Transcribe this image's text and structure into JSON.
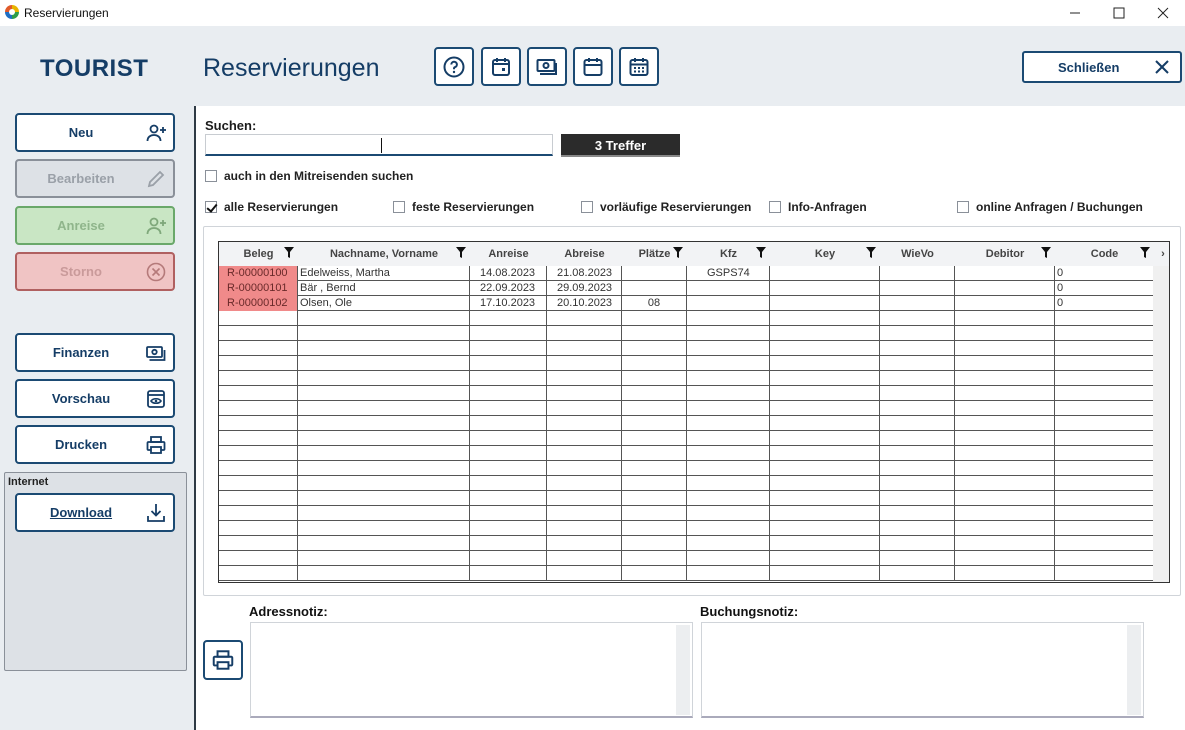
{
  "window": {
    "title": "Reservierungen",
    "minimize": "—",
    "maximize": "☐",
    "close": "✕"
  },
  "header": {
    "brand": "TOURIST",
    "title": "Reservierungen",
    "close_label": "Schließen"
  },
  "sidebar": {
    "neu": "Neu",
    "bearbeiten": "Bearbeiten",
    "anreise": "Anreise",
    "storno": "Storno",
    "finanzen": "Finanzen",
    "vorschau": "Vorschau",
    "drucken": "Drucken",
    "internet_label": "Internet",
    "download": "Download"
  },
  "search": {
    "label": "Suchen:",
    "value": "",
    "result": "3 Treffer",
    "mitreisende": "auch in den Mitreisenden suchen"
  },
  "filters": {
    "alle": "alle Reservierungen",
    "feste": "feste Reservierungen",
    "vorlaeufige": "vorläufige Reservierungen",
    "info": "Info-Anfragen",
    "online": "online Anfragen / Buchungen"
  },
  "grid": {
    "columns": [
      "Beleg",
      "Nachname, Vorname",
      "Anreise",
      "Abreise",
      "Plätze",
      "Kfz",
      "Key",
      "WieVo",
      "Debitor",
      "Code"
    ],
    "rows": [
      [
        "R-00000100",
        "Edelweiss, Martha",
        "14.08.2023",
        "21.08.2023",
        "",
        "GSPS74",
        "",
        "",
        "",
        "0"
      ],
      [
        "R-00000101",
        "Bär , Bernd",
        "22.09.2023",
        "29.09.2023",
        "",
        "",
        "",
        "",
        "",
        "0"
      ],
      [
        "R-00000102",
        "Olsen, Ole",
        "17.10.2023",
        "20.10.2023",
        "08",
        "",
        "",
        "",
        "",
        "0"
      ]
    ]
  },
  "notes": {
    "adress_label": "Adressnotiz:",
    "buchung_label": "Buchungsnotiz:"
  }
}
